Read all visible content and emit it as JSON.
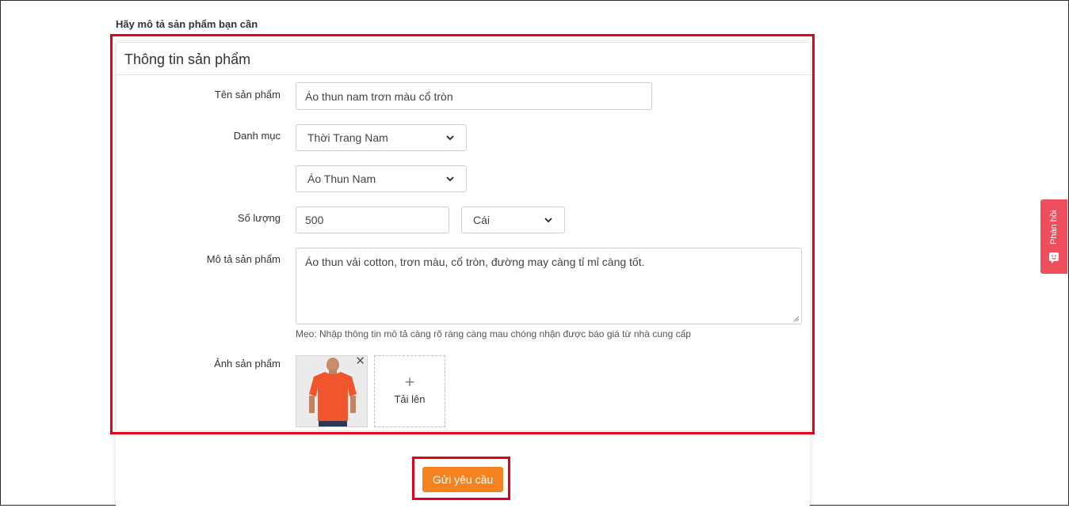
{
  "page": {
    "heading": "Hãy mô tả sản phẩm bạn cần"
  },
  "panel": {
    "title": "Thông tin sản phẩm"
  },
  "form": {
    "product_name": {
      "label": "Tên sản phẩm",
      "value": "Áo thun nam trơn màu cổ tròn"
    },
    "category": {
      "label": "Danh mục",
      "primary_value": "Thời Trang Nam",
      "secondary_value": "Áo Thun Nam"
    },
    "quantity": {
      "label": "Số lượng",
      "value": "500",
      "unit": "Cái"
    },
    "description": {
      "label": "Mô tả sản phẩm",
      "value": "Áo thun vải cotton, trơn màu, cổ tròn, đường may càng tỉ mỉ càng tốt.",
      "hint": "Mẹo: Nhập thông tin mô tả càng rõ ràng càng mau chóng nhận được báo giá từ nhà cung cấp"
    },
    "images": {
      "label": "Ảnh sản phẩm",
      "remove_symbol": "✕",
      "upload_plus": "+",
      "upload_label": "Tải lên"
    }
  },
  "actions": {
    "submit_label": "Gửi yêu cầu"
  },
  "feedback": {
    "label": "Phản hồi"
  },
  "colors": {
    "highlight": "#e5001b",
    "submit_button": "#f4821f",
    "feedback_tab": "#ef4f5d",
    "tshirt": "#f0552b"
  }
}
